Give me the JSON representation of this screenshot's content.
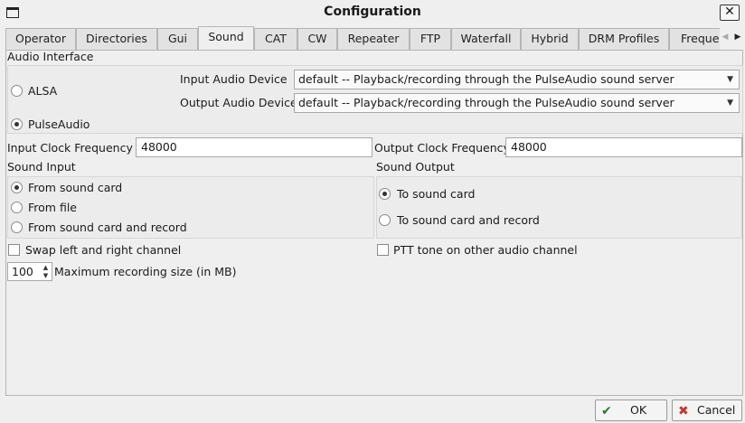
{
  "window": {
    "title": "Configuration"
  },
  "tabs": [
    {
      "label": "Operator"
    },
    {
      "label": "Directories"
    },
    {
      "label": "Gui"
    },
    {
      "label": "Sound"
    },
    {
      "label": "CAT"
    },
    {
      "label": "CW"
    },
    {
      "label": "Repeater"
    },
    {
      "label": "FTP"
    },
    {
      "label": "Waterfall"
    },
    {
      "label": "Hybrid"
    },
    {
      "label": "DRM Profiles"
    },
    {
      "label": "Freque"
    }
  ],
  "active_tab": "Sound",
  "audio_interface": {
    "label": "Audio Interface",
    "alsa_label": "ALSA",
    "pulse_label": "PulseAudio",
    "input_device_label": "Input Audio Device",
    "input_device_value": "default -- Playback/recording through the PulseAudio sound server",
    "output_device_label": "Output Audio Device",
    "output_device_value": "default -- Playback/recording through the PulseAudio sound server"
  },
  "clock": {
    "input_label": "Input  Clock Frequency",
    "input_value": "48000",
    "output_label": "Output Clock Frequency",
    "output_value": "48000"
  },
  "sound_input": {
    "label": "Sound Input",
    "options": [
      "From sound card",
      "From file",
      "From sound card and record"
    ],
    "selected": 0
  },
  "sound_output": {
    "label": "Sound Output",
    "options": [
      "To sound card",
      "To sound card and record"
    ],
    "selected": 0
  },
  "swap_channel_label": "Swap left and right channel",
  "ptt_tone_label": "PTT tone on other audio channel",
  "max_recording": {
    "value": "100",
    "label": "Maximum recording size (in MB)"
  },
  "buttons": {
    "ok": "OK",
    "cancel": "Cancel"
  }
}
